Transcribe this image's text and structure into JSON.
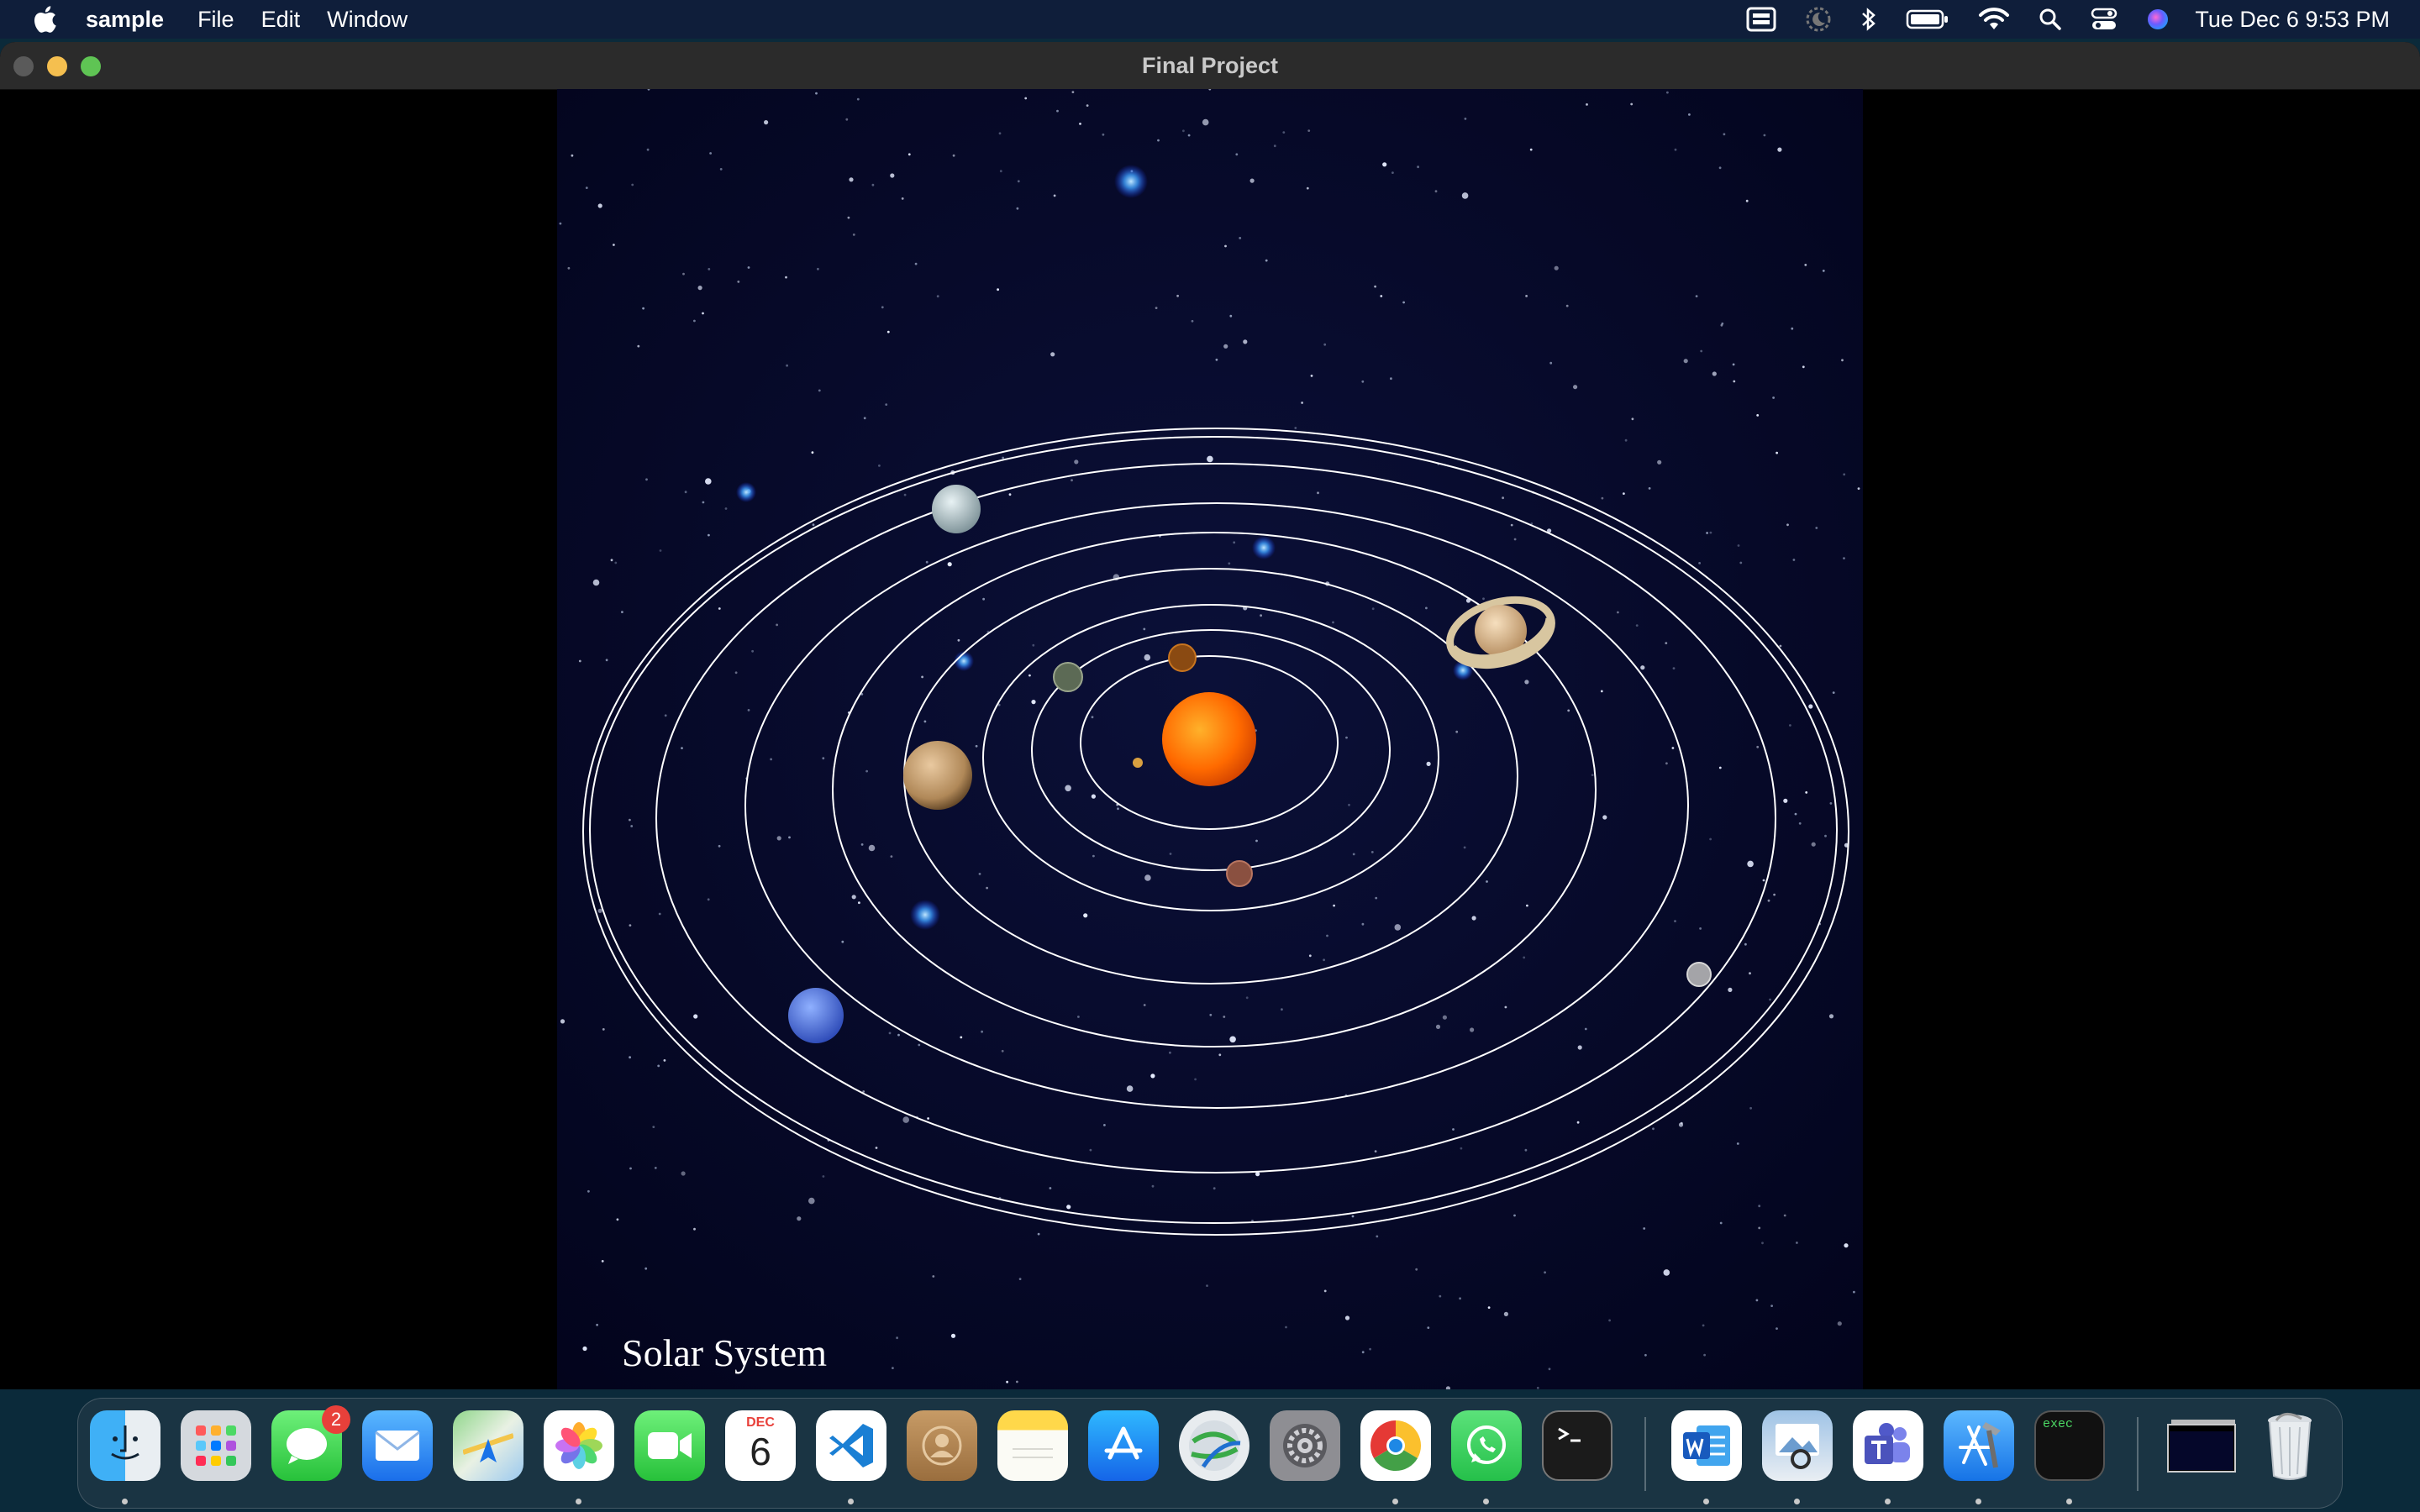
{
  "menubar": {
    "app_name": "sample",
    "menus": [
      "File",
      "Edit",
      "Window"
    ],
    "datetime": "Tue Dec 6  9:53 PM",
    "status_icons": [
      "screen-mirroring-icon",
      "focus-moon-icon",
      "bluetooth-icon",
      "battery-icon",
      "wifi-icon",
      "spotlight-search-icon",
      "control-center-icon",
      "siri-icon"
    ]
  },
  "window": {
    "title": "Final Project",
    "canvas_label": "Solar System",
    "planets": [
      "mercury",
      "venus",
      "earth",
      "mars",
      "jupiter",
      "saturn",
      "uranus",
      "neptune",
      "pluto"
    ],
    "sun_color": "#ff6a00",
    "orbit_color": "#ffffff"
  },
  "dock": {
    "messages_badge": "2",
    "calendar_month": "DEC",
    "calendar_day": "6",
    "exec_label": "exec",
    "apps": [
      "Finder",
      "Launchpad",
      "Messages",
      "Mail",
      "Maps",
      "Photos",
      "FaceTime",
      "Calendar",
      "Visual Studio Code",
      "Contacts",
      "Notes",
      "App Store",
      "Network Utility",
      "System Preferences",
      "Google Chrome",
      "WhatsApp",
      "Terminal",
      "Microsoft Word",
      "Preview",
      "Microsoft Teams",
      "Xcode",
      "exec",
      "Window Stack",
      "Trash"
    ]
  }
}
